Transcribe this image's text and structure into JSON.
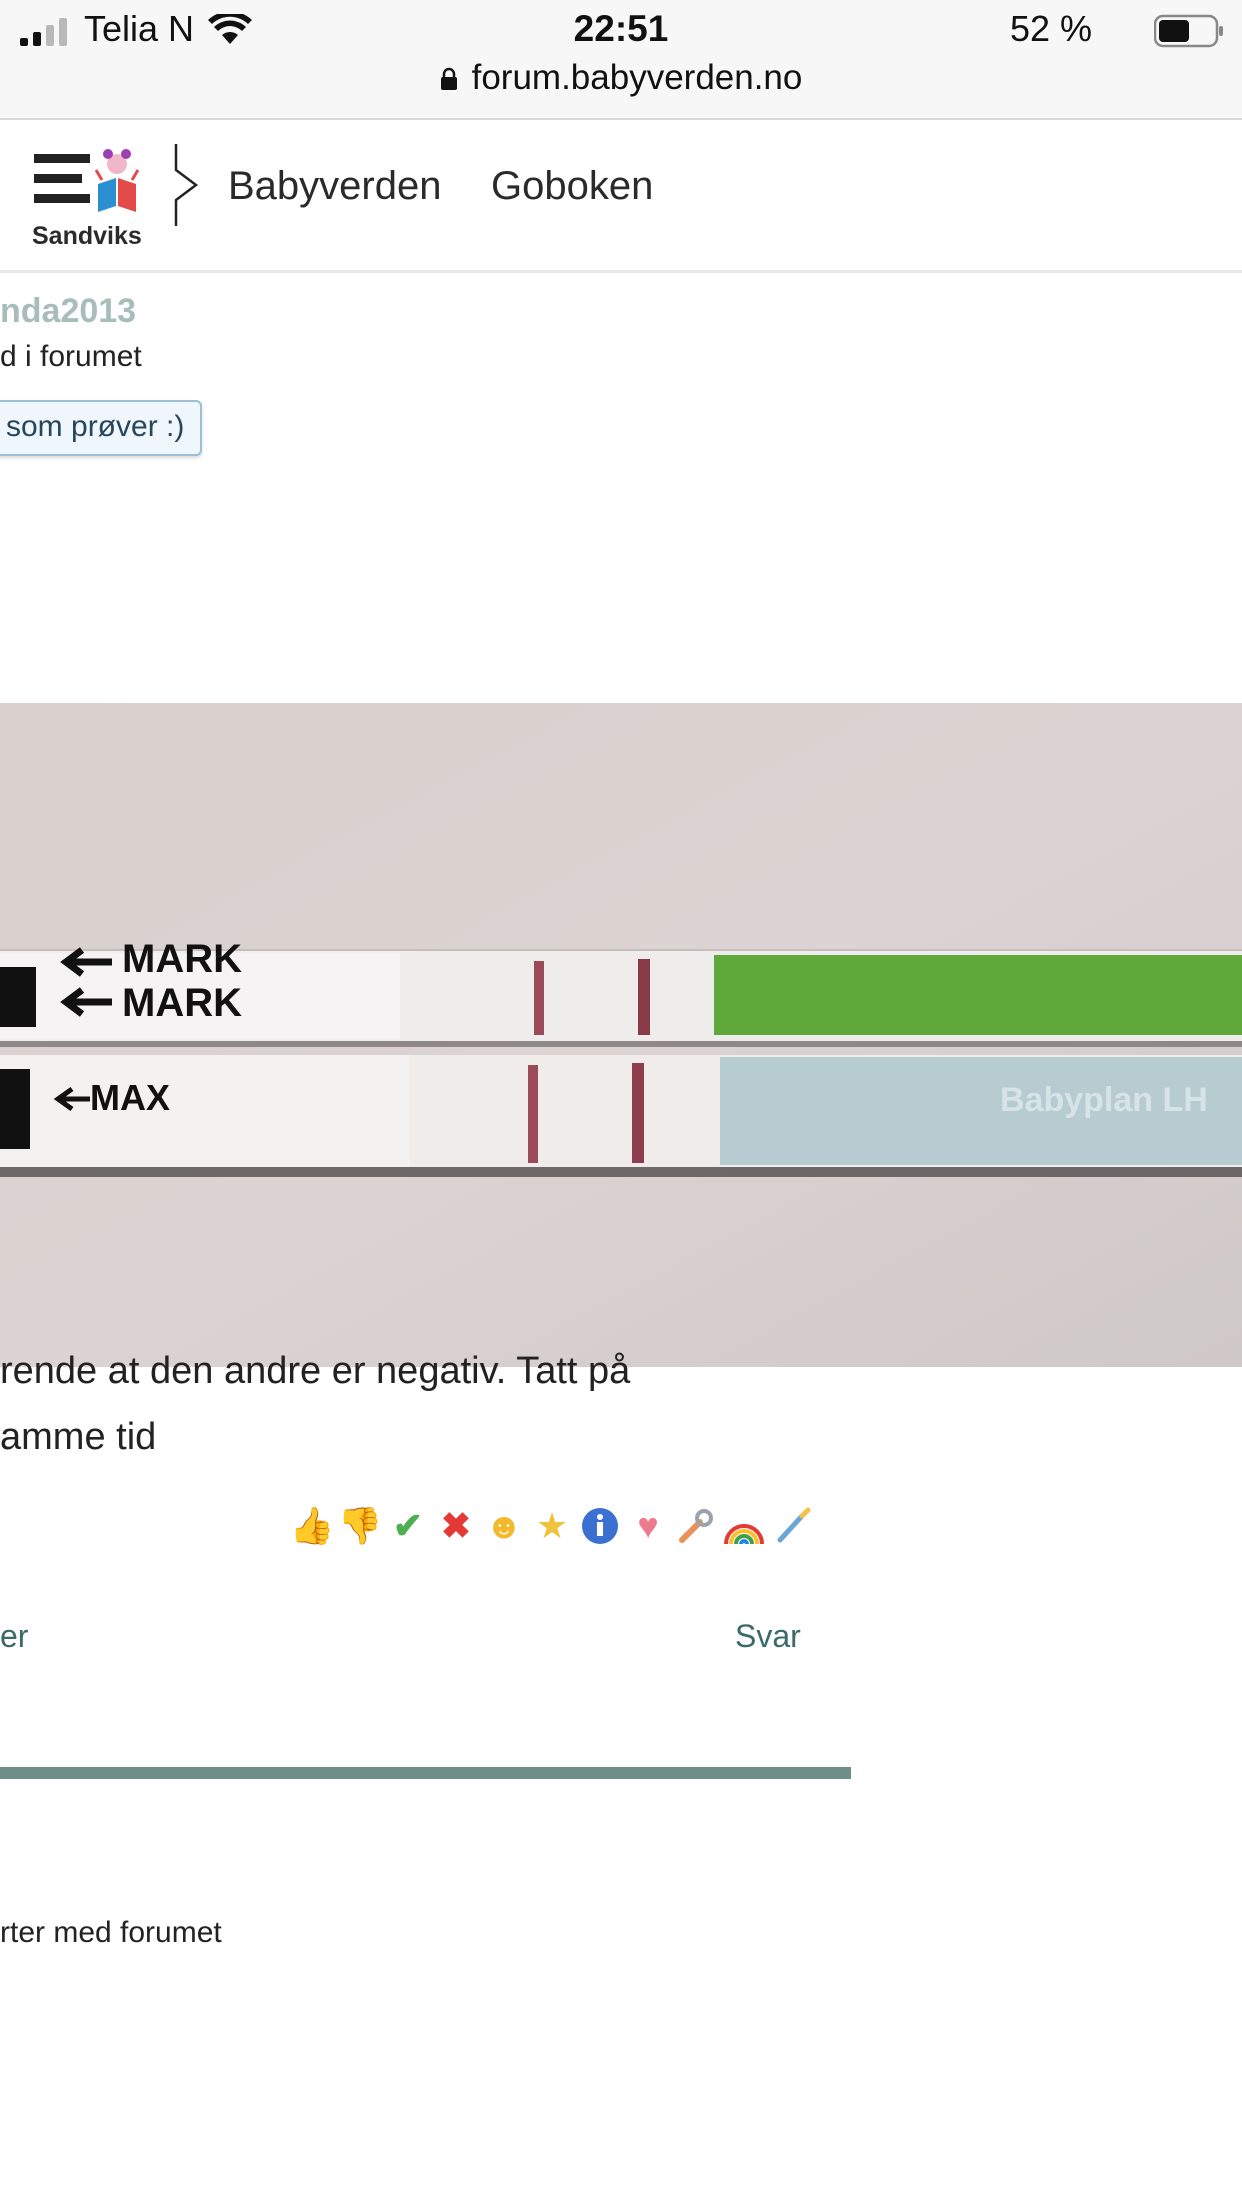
{
  "status_bar": {
    "carrier": "Telia N",
    "time": "22:51",
    "battery": "52 %",
    "url": "forum.babyverden.no",
    "icons": [
      "signal-icon",
      "wifi-icon",
      "lock-icon",
      "battery-icon"
    ]
  },
  "header": {
    "logo_text": "Sandviks",
    "nav": [
      "Babyverden",
      "Goboken"
    ],
    "icons": [
      "menu-icon",
      "chevron-right-icon"
    ]
  },
  "post": {
    "username": "nda2013",
    "member_info": "d i forumet",
    "group_badge": "som prøver :)",
    "photo": {
      "description_labels": [
        "MARK",
        "MARK",
        "MAX",
        "Babyplan LH"
      ]
    },
    "text_lines": [
      "rende at den andre er negativ. Tatt på",
      "amme tid"
    ],
    "reactions": [
      "thumbs-up-icon",
      "thumbs-down-icon",
      "check-icon",
      "cross-icon",
      "grin-icon",
      "star-icon",
      "info-icon",
      "heart-icon",
      "wrench-icon",
      "rainbow-icon",
      "brush-icon"
    ],
    "actions": {
      "left": "er",
      "reply": "Svar"
    }
  },
  "footer": {
    "text": "rter med forumet"
  },
  "colors": {
    "username": "#a7bdb9",
    "link": "#3c6a6a",
    "divider": "#6e8f88",
    "badge_border": "#9bbfd6"
  }
}
